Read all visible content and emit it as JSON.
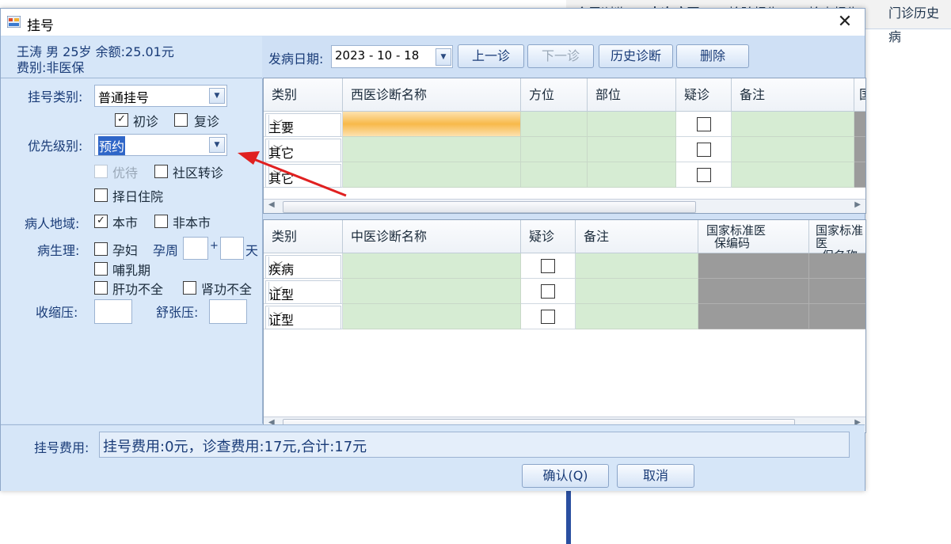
{
  "background": {
    "tabs": [
      "全屏浏览",
      "本次病历",
      "检验报告",
      "检查报告",
      "门诊历史病"
    ]
  },
  "dialog": {
    "title": "挂号",
    "close_glyph": "✕"
  },
  "patient": {
    "line1": "王涛 男 25岁 余额:25.01元",
    "line2": "费别:非医保"
  },
  "form": {
    "reg_type_label": "挂号类别:",
    "reg_type_value": "普通挂号",
    "first_visit_label": "初诊",
    "first_visit_checked": true,
    "revisit_label": "复诊",
    "revisit_checked": false,
    "priority_label": "优先级别:",
    "priority_value": "预约",
    "preferred_label": "优待",
    "community_label": "社区转诊",
    "hospital_label": "择日住院",
    "region_label": "病人地域:",
    "local_label": "本市",
    "local_checked": true,
    "nonlocal_label": "非本市",
    "physio_label": "病生理:",
    "pregnant_label": "孕妇",
    "preg_week_label": "孕周",
    "plus_label": "+",
    "day_label": "天",
    "lactation_label": "哺乳期",
    "liver_label": "肝功不全",
    "kidney_label": "肾功不全",
    "systolic_label": "收缩压:",
    "diastolic_label": "舒张压:",
    "check_glyph": "✓"
  },
  "toolbar": {
    "onset_label": "发病日期:",
    "date_value": "2023 - 10 - 18",
    "prev_label": "上一诊",
    "next_label": "下一诊",
    "history_label": "历史诊断",
    "delete_label": "删除"
  },
  "western_grid": {
    "headers": [
      "类别",
      "西医诊断名称",
      "方位",
      "部位",
      "疑诊",
      "备注",
      "国"
    ],
    "rows": [
      {
        "category": "主要"
      },
      {
        "category": "其它"
      },
      {
        "category": "其它"
      }
    ]
  },
  "chinese_grid": {
    "headers": [
      "类别",
      "中医诊断名称",
      "疑诊",
      "备注",
      "国家标准医保编码",
      "国家标准医保名称"
    ],
    "header_lines": [
      [
        "国家标准医",
        "保编码"
      ],
      [
        "国家标准医",
        "保名称"
      ]
    ],
    "rows": [
      {
        "category": "疾病"
      },
      {
        "category": "证型"
      },
      {
        "category": "证型"
      }
    ]
  },
  "footer": {
    "fee_label": "挂号费用:",
    "fee_text": "挂号费用:0元，诊查费用:17元,合计:17元",
    "confirm_label": "确认(Q)",
    "cancel_label": "取消"
  },
  "colors": {
    "accent": "#2f66c8",
    "grid_green": "#d6ecd3",
    "annotation_arrow": "#e02020"
  }
}
